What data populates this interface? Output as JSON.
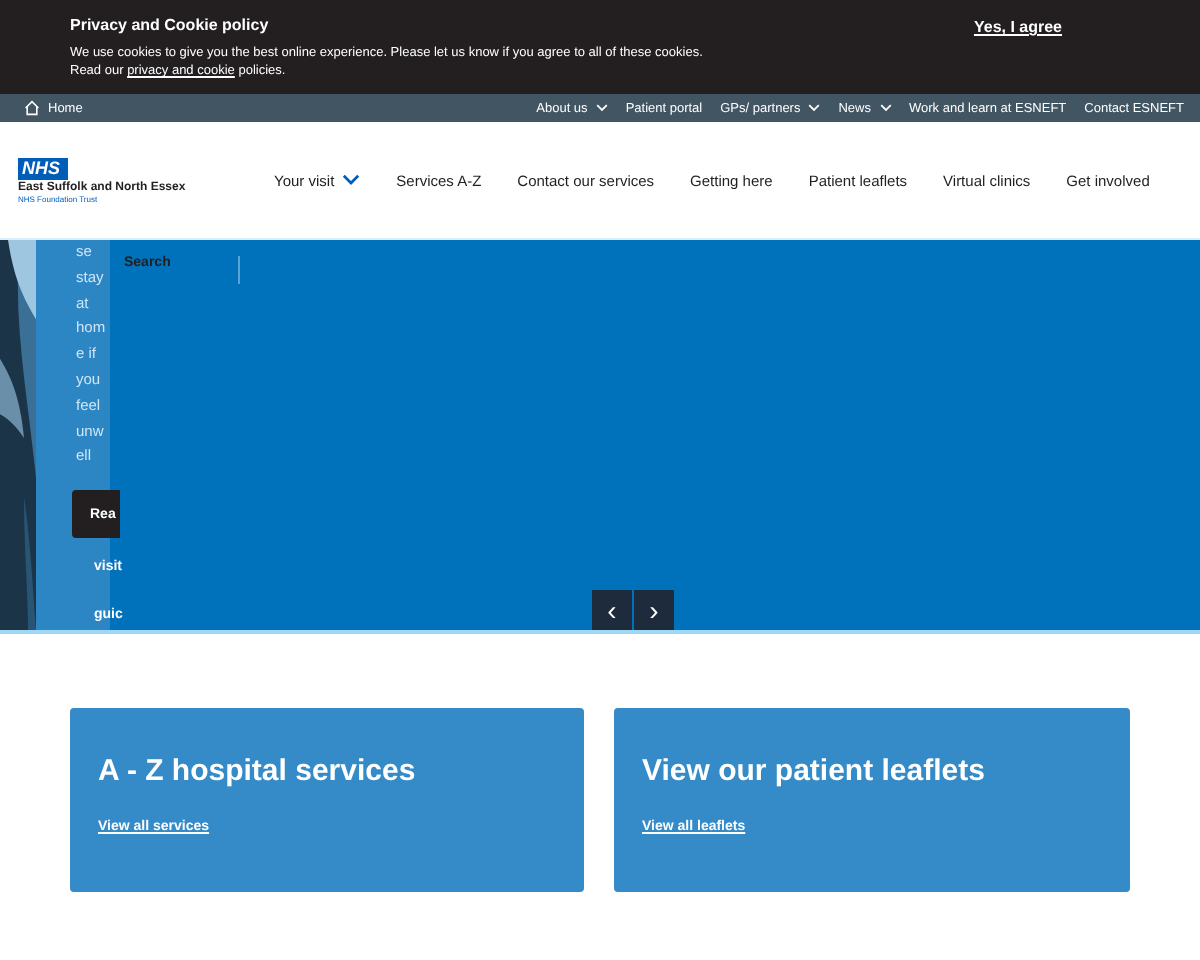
{
  "cookie_banner": {
    "title": "Privacy and Cookie policy",
    "text": "We use cookies to give you the best online experience. Please let us know if you agree to all of these cookies.",
    "text2_before": "Read our",
    "link": "privacy and cookie",
    "text2_after": "policies.",
    "accept": "Yes, I agree"
  },
  "top_nav": {
    "home": "Home",
    "items": [
      {
        "label": "About us",
        "dropdown": true
      },
      {
        "label": "Patient portal",
        "dropdown": false
      },
      {
        "label": "GPs/ partners",
        "dropdown": true
      },
      {
        "label": "News",
        "dropdown": true
      },
      {
        "label": "Work and learn at ESNEFT",
        "dropdown": false
      },
      {
        "label": "Contact ESNEFT",
        "dropdown": false
      }
    ]
  },
  "logo": {
    "badge": "NHS",
    "name": "East Suffolk and North Essex",
    "sub": "NHS Foundation Trust"
  },
  "main_nav": [
    {
      "label": "Your visit",
      "dropdown": true
    },
    {
      "label": "Services A-Z",
      "dropdown": false
    },
    {
      "label": "Contact our services",
      "dropdown": false
    },
    {
      "label": "Getting here",
      "dropdown": false
    },
    {
      "label": "Patient leaflets",
      "dropdown": false
    },
    {
      "label": "Virtual clinics",
      "dropdown": false
    },
    {
      "label": "Get involved",
      "dropdown": false
    }
  ],
  "hero": {
    "message_lines": [
      "se",
      "stay",
      "at",
      "hom",
      "e if",
      "you",
      "feel",
      "unw",
      "ell"
    ],
    "button": "Rea",
    "links": [
      "visit",
      "guic"
    ],
    "search": "Search",
    "prev": "‹",
    "next": "›"
  },
  "cards": [
    {
      "title": "A - Z hospital services",
      "link": "View all services"
    },
    {
      "title": "View our patient leaflets",
      "link": "View all leaflets"
    }
  ]
}
